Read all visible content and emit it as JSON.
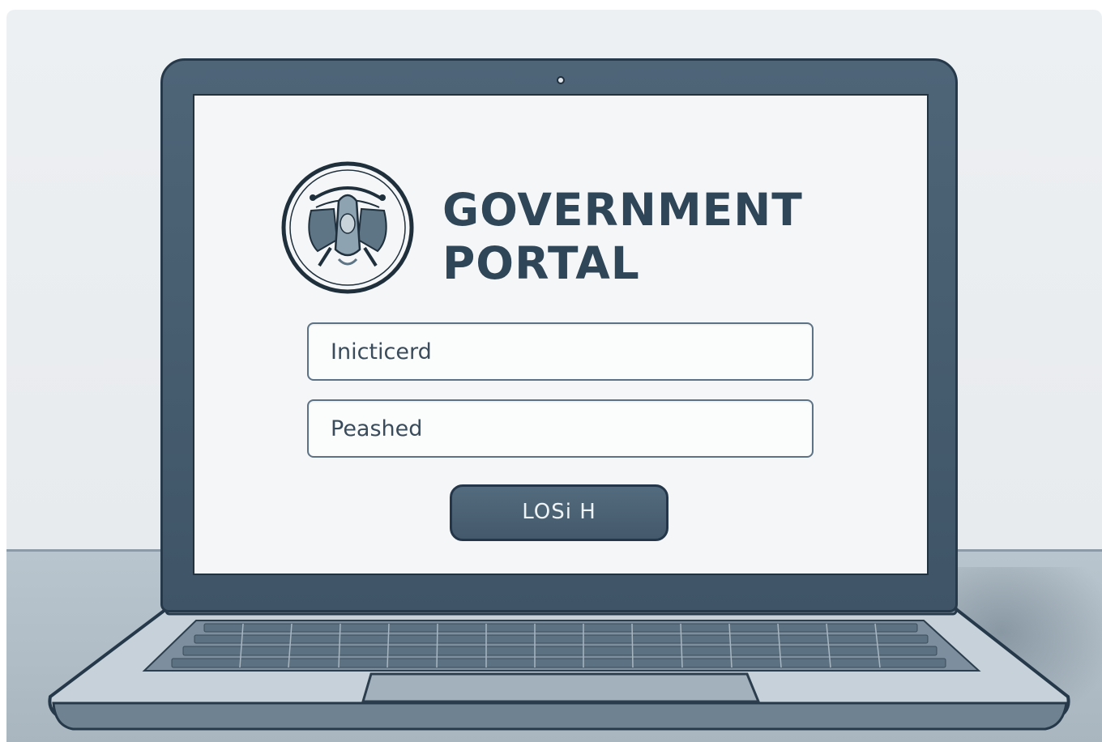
{
  "portal": {
    "title_line1": "GOVERNMENT",
    "title_line2": "PORTAL",
    "seal_icon": "government-seal-icon"
  },
  "form": {
    "username_value": "Inicticerd",
    "password_value": "Peashed",
    "login_label": "LOSi H"
  },
  "colors": {
    "accent": "#2f4558",
    "laptop_body": "#4e6578",
    "screen_bg": "#f4f6f7",
    "desk": "#b0bcc6"
  }
}
